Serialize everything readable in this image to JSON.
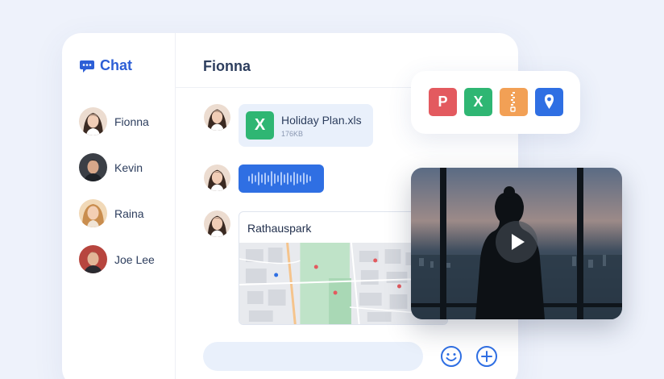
{
  "sidebar": {
    "brand": {
      "icon": "chat-bubble-icon",
      "label": "Chat"
    },
    "contacts": [
      {
        "name": "Fionna"
      },
      {
        "name": "Kevin"
      },
      {
        "name": "Raina"
      },
      {
        "name": "Joe Lee"
      }
    ]
  },
  "conversation": {
    "title": "Fionna",
    "messages": [
      {
        "type": "file",
        "file_name": "Holiday Plan.xls",
        "file_size": "176KB",
        "file_icon": "X"
      },
      {
        "type": "voice",
        "icon": "waveform-icon"
      },
      {
        "type": "location",
        "place": "Rathauspark"
      }
    ]
  },
  "composer": {
    "placeholder": ""
  },
  "actions": {
    "emoji": "emoji-icon",
    "add": "plus-icon"
  },
  "attachments": [
    {
      "label": "P",
      "color": "#e35a5f"
    },
    {
      "label": "X",
      "color": "#2fb673"
    },
    {
      "label": "",
      "color": "#f2a055",
      "icon": "zip-icon"
    },
    {
      "label": "",
      "color": "#2f6fe3",
      "icon": "location-pin-icon"
    }
  ],
  "video": {
    "icon": "play-icon"
  },
  "colors": {
    "accent": "#2f6fe3",
    "background": "#eef2fb",
    "bubble": "#e9f0fb"
  }
}
